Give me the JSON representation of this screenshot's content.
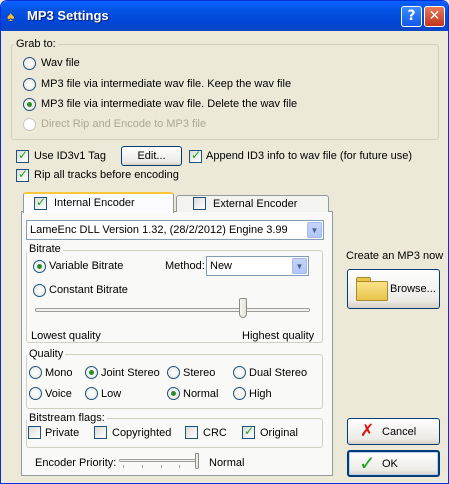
{
  "window": {
    "title": "MP3 Settings",
    "help_label": "?",
    "close_label": "✕",
    "app_icon": "mp3-app-icon"
  },
  "grab_to": {
    "legend": "Grab to:",
    "options": [
      {
        "label": "Wav file",
        "selected": false,
        "enabled": true
      },
      {
        "label": "MP3 file via intermediate wav file. Keep the wav file",
        "selected": false,
        "enabled": true
      },
      {
        "label": "MP3 file via intermediate wav file. Delete the wav file",
        "selected": true,
        "enabled": true
      },
      {
        "label": "Direct Rip and Encode to MP3 file",
        "selected": false,
        "enabled": false
      }
    ]
  },
  "id3": {
    "use_label": "Use ID3v1 Tag",
    "use_checked": true,
    "edit_label": "Edit...",
    "append_label": "Append ID3 info to wav file (for future use)",
    "append_checked": true
  },
  "rip_all": {
    "label": "Rip all tracks before encoding",
    "checked": true
  },
  "tabs": {
    "internal": {
      "label": "Internal Encoder",
      "checked": true
    },
    "external": {
      "label": "External Encoder",
      "checked": false
    }
  },
  "encoder_select": {
    "value": "LameEnc DLL Version 1.32, (28/2/2012) Engine 3.99"
  },
  "bitrate": {
    "legend": "Bitrate",
    "variable_label": "Variable Bitrate",
    "variable_selected": true,
    "method_label": "Method:",
    "method_value": "New",
    "constant_label": "Constant Bitrate",
    "constant_selected": false,
    "quality_level": 0.78,
    "lowest_label": "Lowest quality",
    "highest_label": "Highest quality"
  },
  "quality": {
    "legend": "Quality",
    "row1": [
      {
        "label": "Mono",
        "selected": false
      },
      {
        "label": "Joint Stereo",
        "selected": true
      },
      {
        "label": "Stereo",
        "selected": false
      },
      {
        "label": "Dual Stereo",
        "selected": false
      }
    ],
    "row2": [
      {
        "label": "Voice",
        "selected": false
      },
      {
        "label": "Low",
        "selected": false
      },
      {
        "label": "Normal",
        "selected": true
      },
      {
        "label": "High",
        "selected": false
      }
    ]
  },
  "bitstream": {
    "legend": "Bitstream flags:",
    "flags": [
      {
        "label": "Private",
        "checked": false
      },
      {
        "label": "Copyrighted",
        "checked": false
      },
      {
        "label": "CRC",
        "checked": false
      },
      {
        "label": "Original",
        "checked": true
      }
    ]
  },
  "priority": {
    "label": "Encoder Priority:",
    "value_label": "Normal",
    "level": 1.0
  },
  "create_mp3": {
    "label": "Create an MP3 now",
    "browse_label": "Browse..."
  },
  "cancel_label": "Cancel",
  "ok_label": "OK"
}
